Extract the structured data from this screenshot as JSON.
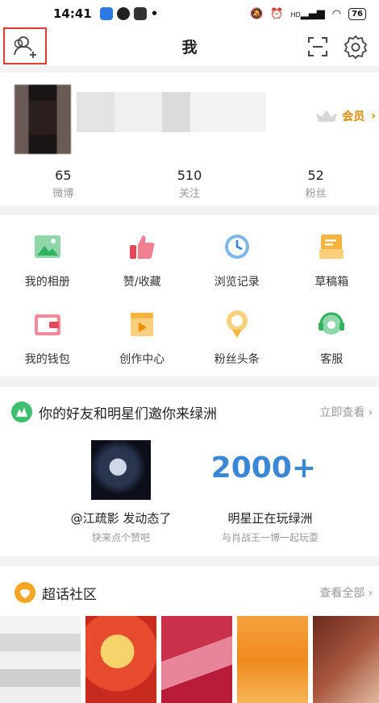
{
  "status_bar": {
    "time": "14:41",
    "dot": "•",
    "battery": "76",
    "network": "HD"
  },
  "nav": {
    "title": "我"
  },
  "profile": {
    "vip_label": "会员",
    "stats": [
      {
        "num": "65",
        "label": "微博"
      },
      {
        "num": "510",
        "label": "关注"
      },
      {
        "num": "52",
        "label": "粉丝"
      }
    ]
  },
  "grid": [
    {
      "label": "我的相册",
      "icon": "photo-album-icon"
    },
    {
      "label": "赞/收藏",
      "icon": "like-icon"
    },
    {
      "label": "浏览记录",
      "icon": "history-clock-icon"
    },
    {
      "label": "草稿箱",
      "icon": "drafts-icon"
    },
    {
      "label": "我的钱包",
      "icon": "wallet-icon"
    },
    {
      "label": "创作中心",
      "icon": "creator-icon"
    },
    {
      "label": "粉丝头条",
      "icon": "fan-headline-icon"
    },
    {
      "label": "客服",
      "icon": "customer-service-icon"
    }
  ],
  "oasis": {
    "title": "你的好友和明星们邀你来绿洲",
    "more": "立即查看",
    "big_number": "2000+",
    "left_caption": "@江疏影 发动态了",
    "left_sub": "快来点个赞吧",
    "right_caption": "明星正在玩绿洲",
    "right_sub": "与肖战王一博一起玩耍"
  },
  "super_topic": {
    "title": "超话社区",
    "more": "查看全部"
  },
  "colors": {
    "accent_orange": "#e08a00",
    "blue": "#3a87d8",
    "red_highlight": "#e53935"
  }
}
